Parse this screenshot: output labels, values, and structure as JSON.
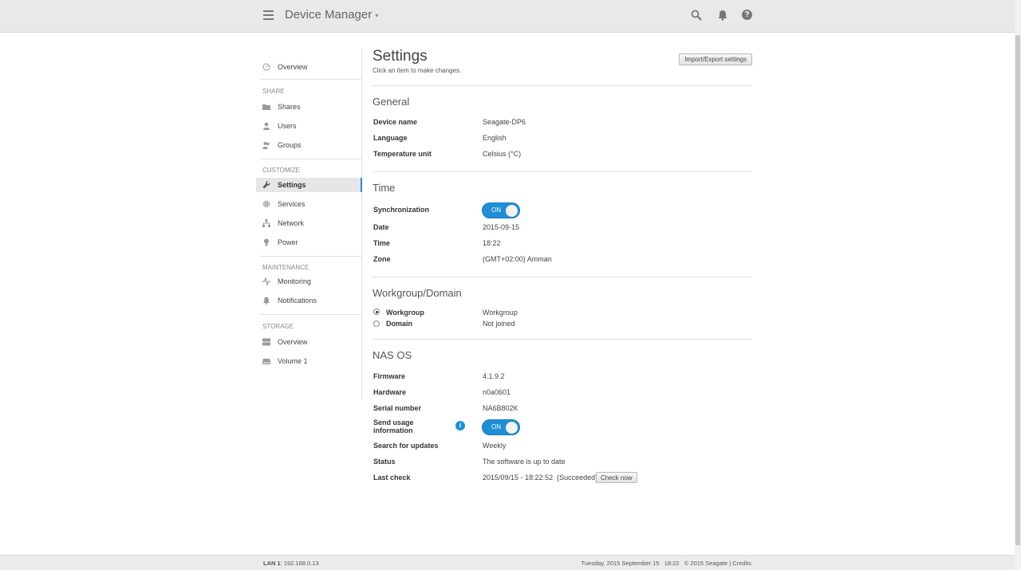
{
  "header": {
    "title": "Device Manager",
    "caret": "▾",
    "help_glyph": "?"
  },
  "sidebar": {
    "overview": "Overview",
    "share_section": "SHARE",
    "share_items": [
      {
        "label": "Shares",
        "icon": "folder-icon"
      },
      {
        "label": "Users",
        "icon": "user-icon"
      },
      {
        "label": "Groups",
        "icon": "group-icon"
      }
    ],
    "customize_section": "CUSTOMIZE",
    "customize_items": [
      {
        "label": "Settings",
        "icon": "wrench-icon",
        "active": true
      },
      {
        "label": "Services",
        "icon": "gear-icon"
      },
      {
        "label": "Network",
        "icon": "network-icon"
      },
      {
        "label": "Power",
        "icon": "bulb-icon"
      }
    ],
    "maintenance_section": "MAINTENANCE",
    "maintenance_items": [
      {
        "label": "Monitoring",
        "icon": "pulse-icon"
      },
      {
        "label": "Notifications",
        "icon": "bell-icon"
      }
    ],
    "storage_section": "STORAGE",
    "storage_items": [
      {
        "label": "Overview",
        "icon": "storage-icon"
      },
      {
        "label": "Volume 1",
        "icon": "disk-icon"
      }
    ]
  },
  "main": {
    "title": "Settings",
    "subtitle": "Click an item to make changes.",
    "import_export_label": "Import/Export settings",
    "general": {
      "title": "General",
      "rows": [
        {
          "label": "Device name",
          "value": "Seagate-DP6"
        },
        {
          "label": "Language",
          "value": "English"
        },
        {
          "label": "Temperature unit",
          "value": "Celsius (°C)"
        }
      ]
    },
    "time": {
      "title": "Time",
      "sync_label": "Synchronization",
      "sync_state": "ON",
      "rows": [
        {
          "label": "Date",
          "value": "2015-09-15"
        },
        {
          "label": "Time",
          "value": "18:22"
        },
        {
          "label": "Zone",
          "value": "(GMT+02:00) Amman"
        }
      ]
    },
    "workgroup": {
      "title": "Workgroup/Domain",
      "options": [
        {
          "label": "Workgroup",
          "value": "Workgroup",
          "selected": true
        },
        {
          "label": "Domain",
          "value": "Not joined",
          "selected": false
        }
      ]
    },
    "nasos": {
      "title": "NAS OS",
      "rows": [
        {
          "label": "Firmware",
          "value": "4.1.9.2"
        },
        {
          "label": "Hardware",
          "value": "n0a0601"
        },
        {
          "label": "Serial number",
          "value": "NA6B802K"
        }
      ],
      "usage_label_1": "Send usage",
      "usage_label_2": "information",
      "usage_state": "ON",
      "info_glyph": "i",
      "rows2": [
        {
          "label": "Search for updates",
          "value": "Weekly"
        },
        {
          "label": "Status",
          "value": "The software is up to date"
        },
        {
          "label": "Last check",
          "value": "2015/09/15 - 18:22:52  (Succeeded)"
        }
      ],
      "check_now_label": "Check now"
    }
  },
  "footer": {
    "lan_label": "LAN 1",
    "lan_value": ": 192.168.0.13",
    "right_text": "Tuesday, 2015 September 15   18:22   © 2015 Seagate | Credits"
  },
  "colors": {
    "accent": "#1e8fd6",
    "header_bg": "#e9e9e9"
  }
}
